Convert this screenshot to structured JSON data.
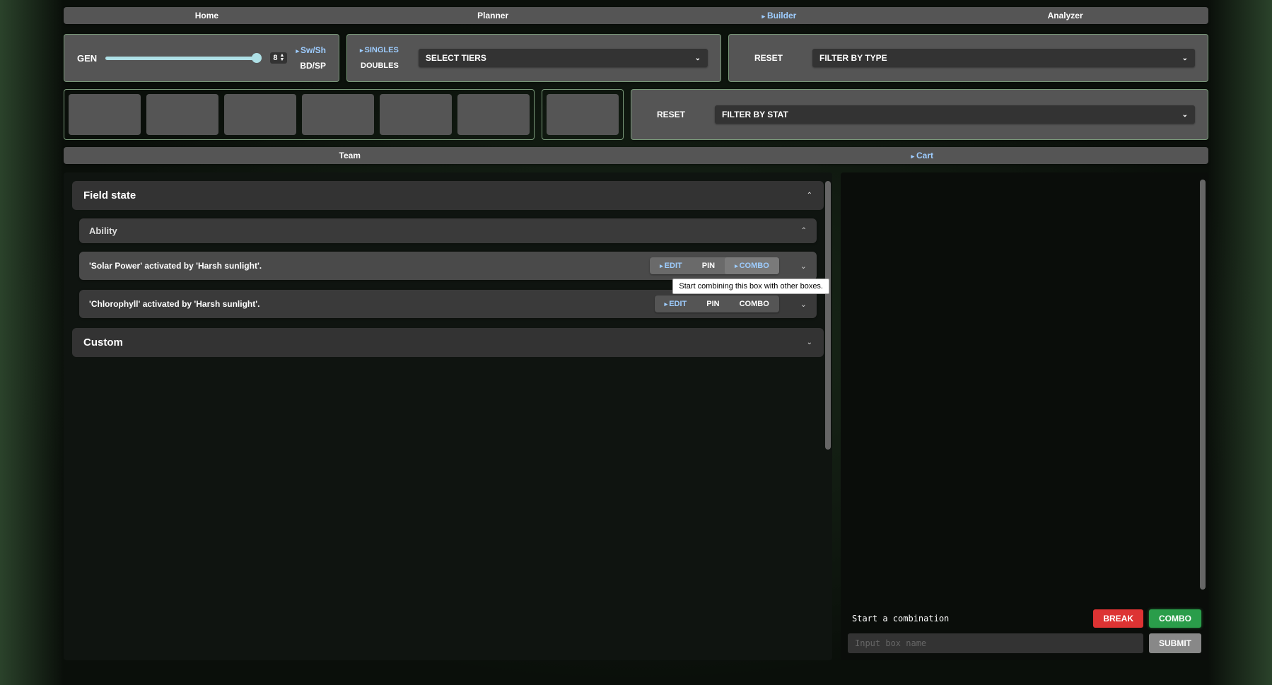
{
  "nav": {
    "items": [
      "Home",
      "Planner",
      "Builder",
      "Analyzer"
    ],
    "active": "Builder"
  },
  "gen": {
    "label": "GEN",
    "value": "8",
    "options": [
      "Sw/Sh",
      "BD/SP"
    ],
    "selected": "Sw/Sh"
  },
  "format": {
    "options": [
      "SINGLES",
      "DOUBLES"
    ],
    "selected": "SINGLES",
    "tiers_label": "SELECT TIERS"
  },
  "filters": {
    "reset": "RESET",
    "type": "FILTER BY TYPE",
    "stat": "FILTER BY STAT"
  },
  "subnav": {
    "items": [
      "Team",
      "Cart"
    ],
    "active": "Cart"
  },
  "sections": {
    "field_state": "Field state",
    "ability": "Ability",
    "custom": "Custom"
  },
  "entries": [
    {
      "text": "'Solar Power' activated by 'Harsh sunlight'."
    },
    {
      "text": "'Chlorophyll' activated by 'Harsh sunlight'."
    }
  ],
  "entry_buttons": {
    "edit": "EDIT",
    "pin": "PIN",
    "combo": "COMBO"
  },
  "tooltip": "Start combining this box with other boxes.",
  "combo_footer": {
    "text": "Start a combination",
    "break": "BREAK",
    "combo": "COMBO",
    "submit": "SUBMIT",
    "placeholder": "Input box name"
  }
}
